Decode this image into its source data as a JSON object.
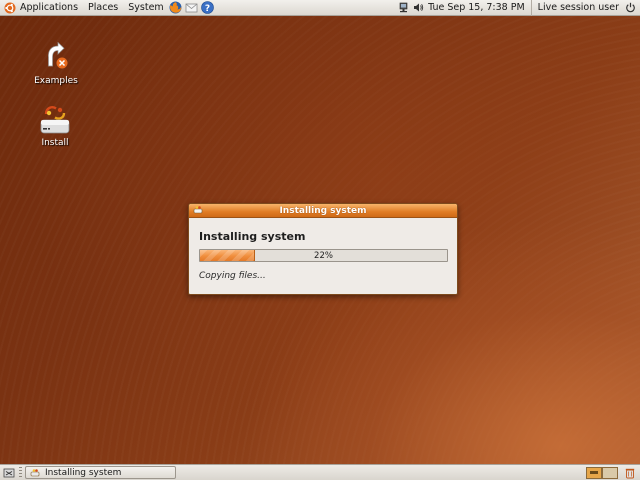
{
  "top_panel": {
    "menus": [
      "Applications",
      "Places",
      "System"
    ],
    "clock": "Tue Sep 15,  7:38 PM",
    "user": "Live session user"
  },
  "desktop_icons": [
    {
      "label": "Examples",
      "icon": "examples-icon"
    },
    {
      "label": "Install",
      "icon": "install-icon"
    }
  ],
  "dialog": {
    "title": "Installing system",
    "heading": "Installing system",
    "progress_percent": 22,
    "progress_text": "22%",
    "status": "Copying files..."
  },
  "bottom_panel": {
    "task": "Installing system",
    "workspaces": 2,
    "active_workspace": 1
  },
  "colors": {
    "titlebar": "#e07c25",
    "progress_fill": "#f08e3d",
    "wallpaper": "#7a3212"
  }
}
